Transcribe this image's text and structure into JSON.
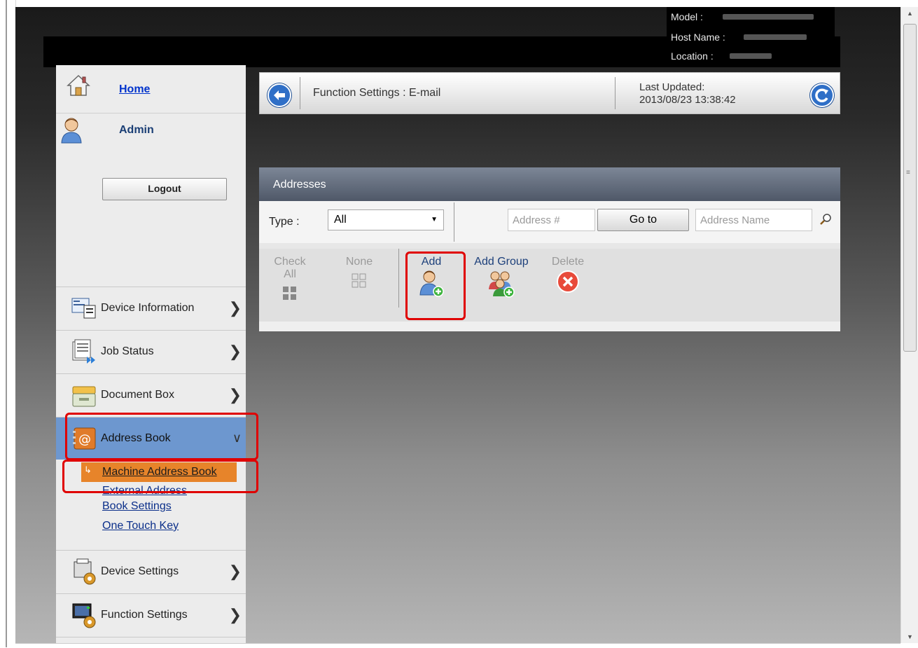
{
  "header": {
    "model_label": "Model :",
    "host_label": "Host Name :",
    "location_label": "Location :"
  },
  "sidebar": {
    "home": "Home",
    "admin": "Admin",
    "logout": "Logout",
    "items": [
      {
        "label": "Device Information",
        "icon": "device-info-icon"
      },
      {
        "label": "Job Status",
        "icon": "job-status-icon"
      },
      {
        "label": "Document Box",
        "icon": "document-box-icon"
      },
      {
        "label": "Address Book",
        "icon": "address-book-icon"
      },
      {
        "label": "Device Settings",
        "icon": "device-settings-icon"
      },
      {
        "label": "Function Settings",
        "icon": "function-settings-icon"
      }
    ],
    "submenu": {
      "selected": "Machine Address Book",
      "ext_line1": "External Address",
      "ext_line2": "Book Settings",
      "one_touch": "One Touch Key"
    }
  },
  "topbar": {
    "title": "Function Settings : E-mail",
    "updated_label": "Last Updated:",
    "updated_value": "2013/08/23 13:38:42"
  },
  "panel": {
    "title": "Addresses",
    "type_label": "Type :",
    "type_value": "All",
    "address_num_placeholder": "Address #",
    "goto": "Go to",
    "address_name_placeholder": "Address Name",
    "actions": {
      "check_all": "Check All",
      "none": "None",
      "add": "Add",
      "add_group": "Add Group",
      "delete": "Delete"
    }
  },
  "colors": {
    "highlight": "#e00000",
    "selected_submenu": "#e7842a",
    "active_nav": "#6d97cf"
  }
}
